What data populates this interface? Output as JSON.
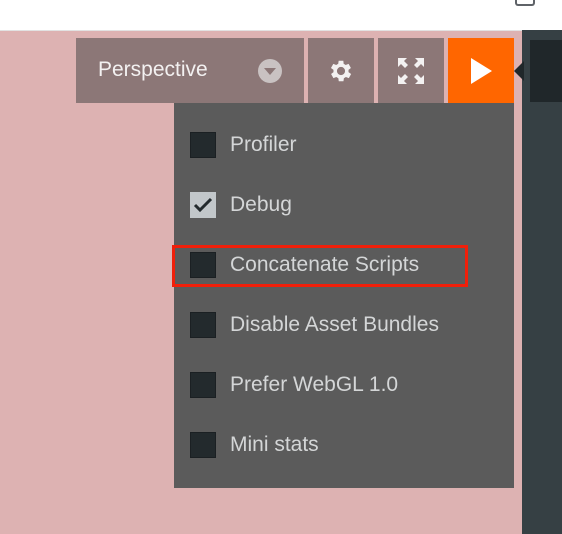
{
  "toolbar": {
    "camera_label": "Perspective",
    "camera_caret_icon": "chevron-down-circle-icon",
    "settings_icon": "gear-icon",
    "fullscreen_icon": "fullscreen-icon",
    "launch_icon": "play-icon",
    "launch_color": "#ff6600"
  },
  "menu": {
    "items": [
      {
        "label": "Profiler",
        "checked": false
      },
      {
        "label": "Debug",
        "checked": true
      },
      {
        "label": "Concatenate Scripts",
        "checked": false,
        "highlighted": true
      },
      {
        "label": "Disable Asset Bundles",
        "checked": false
      },
      {
        "label": "Prefer WebGL 1.0",
        "checked": false
      },
      {
        "label": "Mini stats",
        "checked": false
      }
    ]
  },
  "colors": {
    "viewport_bg": "#ddb2b2",
    "menu_bg": "#5b5b5b",
    "highlight_border": "#f01f0a"
  }
}
